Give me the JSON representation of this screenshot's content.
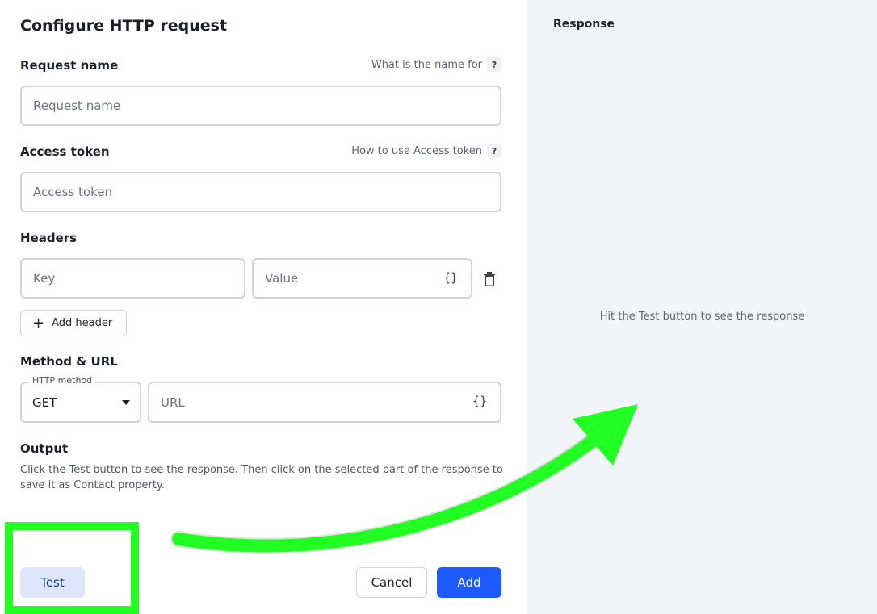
{
  "form": {
    "title": "Configure HTTP request",
    "request_name": {
      "label": "Request name",
      "help_text": "What is the name for",
      "placeholder": "Request name"
    },
    "access_token": {
      "label": "Access token",
      "help_text": "How to use Access token",
      "placeholder": "Access token"
    },
    "headers": {
      "label": "Headers",
      "key_placeholder": "Key",
      "value_placeholder": "Value",
      "brace_icon": "{}",
      "add_label": "Add header"
    },
    "method_url": {
      "label": "Method & URL",
      "method_legend": "HTTP method",
      "method_value": "GET",
      "url_placeholder": "URL",
      "brace_icon": "{}"
    },
    "output": {
      "label": "Output",
      "description": "Click the Test button to see the response. Then click on the selected part of the response to save it as Contact property."
    },
    "help_icon": "?",
    "buttons": {
      "test": "Test",
      "cancel": "Cancel",
      "add": "Add"
    }
  },
  "response": {
    "title": "Response",
    "empty_text": "Hit the Test button to see the response"
  },
  "colors": {
    "primary": "#1e5bff",
    "test_button_bg": "#dde6fb",
    "response_panel_bg": "#f1f4f8",
    "annotation_green": "#22ff22"
  },
  "annotations": {
    "highlight_box": "green-highlight-box",
    "arrow": "green-curved-arrow"
  }
}
